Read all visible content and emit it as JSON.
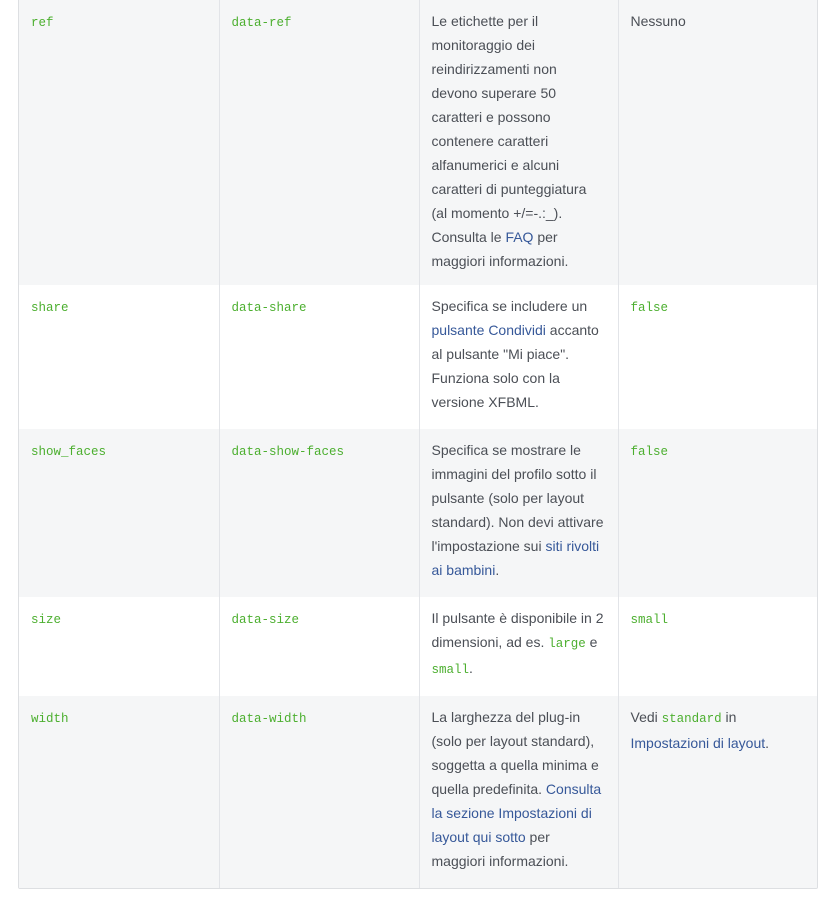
{
  "rows": [
    {
      "setting": "ref",
      "attribute": "data-ref",
      "desc_before": "Le etichette per il monitoraggio dei reindirizzamenti non devono superare 50 caratteri e possono contenere caratteri alfanumerici e alcuni caratteri di punteggiatura (al momento +/=-.:_). Consulta le ",
      "desc_link": "FAQ",
      "desc_after": " per maggiori informazioni.",
      "default": "Nessuno"
    },
    {
      "setting": "share",
      "attribute": "data-share",
      "desc_before": "Specifica se includere un ",
      "desc_link": "pulsante Condividi",
      "desc_after": " accanto al pulsante \"Mi piace\". Funziona solo con la versione XFBML.",
      "default": "false"
    },
    {
      "setting": "show_faces",
      "attribute": "data-show-faces",
      "desc_before": "Specifica se mostrare le immagini del profilo sotto il pulsante (solo per layout standard). Non devi attivare l'impostazione sui ",
      "desc_link": "siti rivolti ai bambini",
      "desc_after": ".",
      "default": "false"
    },
    {
      "setting": "size",
      "attribute": "data-size",
      "desc_before": "Il pulsante è disponibile in 2 dimensioni, ad es. ",
      "desc_code1": "large",
      "desc_mid": " e ",
      "desc_code2": "small",
      "desc_after": ".",
      "default": "small"
    },
    {
      "setting": "width",
      "attribute": "data-width",
      "desc_before": "La larghezza del plug-in (solo per layout standard), soggetta a quella minima e quella predefinita. ",
      "desc_link": "Consulta la sezione Impostazioni di layout qui sotto",
      "desc_after": " per maggiori informazioni.",
      "default_before": "Vedi ",
      "default_code": "standard",
      "default_mid": " in ",
      "default_link": "Impostazioni di layout",
      "default_after": "."
    }
  ],
  "colors": {
    "code": "#4caf2f",
    "link": "#365899",
    "text": "#4b4f56",
    "alt_row": "#f5f6f7"
  }
}
